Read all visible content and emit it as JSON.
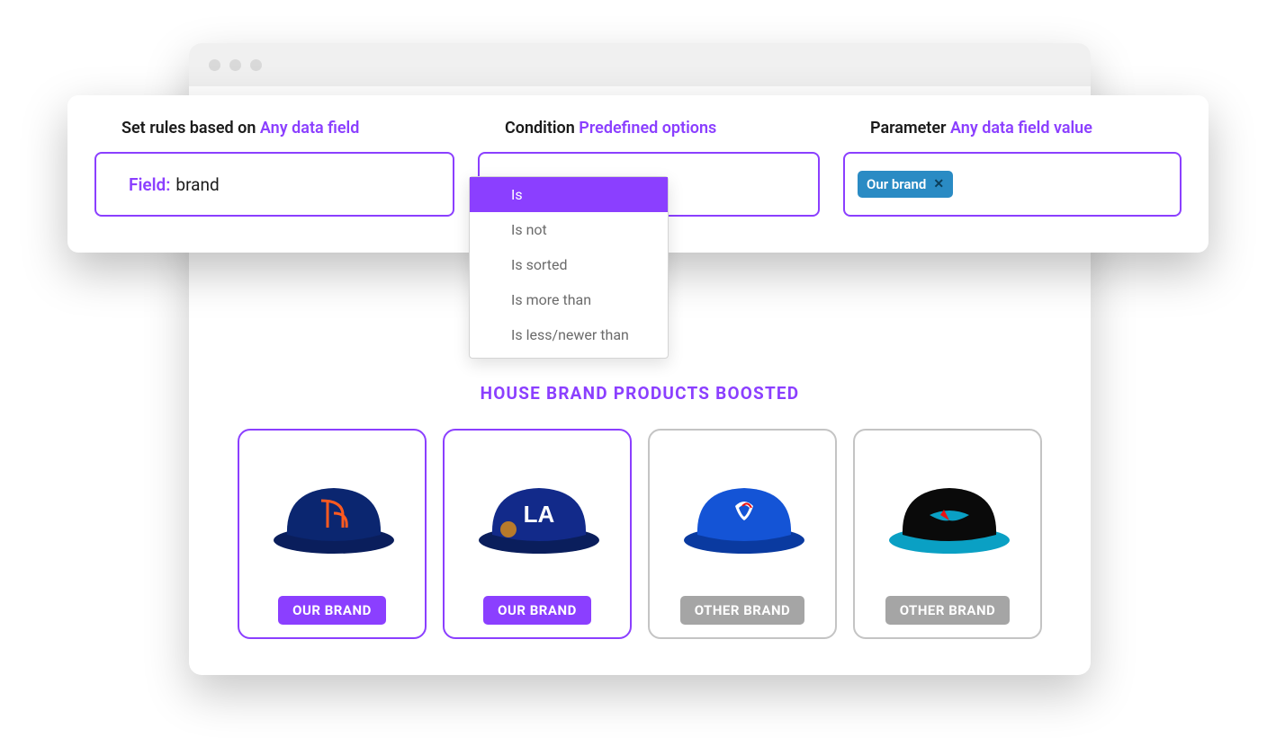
{
  "rules": {
    "field": {
      "labelPrefix": "Set rules based on",
      "labelHighlight": "Any data field",
      "fieldLabel": "Field:",
      "fieldValue": "brand"
    },
    "condition": {
      "labelPrefix": "Condition",
      "labelHighlight": "Predefined options",
      "options": [
        "Is",
        "Is not",
        "Is sorted",
        "Is more than",
        "Is less/newer than"
      ],
      "selectedIndex": 0
    },
    "parameter": {
      "labelPrefix": "Parameter",
      "labelHighlight": "Any data field value",
      "tagText": "Our brand"
    }
  },
  "sectionTitle": "HOUSE BRAND PRODUCTS BOOSTED",
  "products": [
    {
      "badge": "OUR BRAND",
      "boosted": true
    },
    {
      "badge": "OUR BRAND",
      "boosted": true
    },
    {
      "badge": "OTHER BRAND",
      "boosted": false
    },
    {
      "badge": "OTHER BRAND",
      "boosted": false
    }
  ]
}
